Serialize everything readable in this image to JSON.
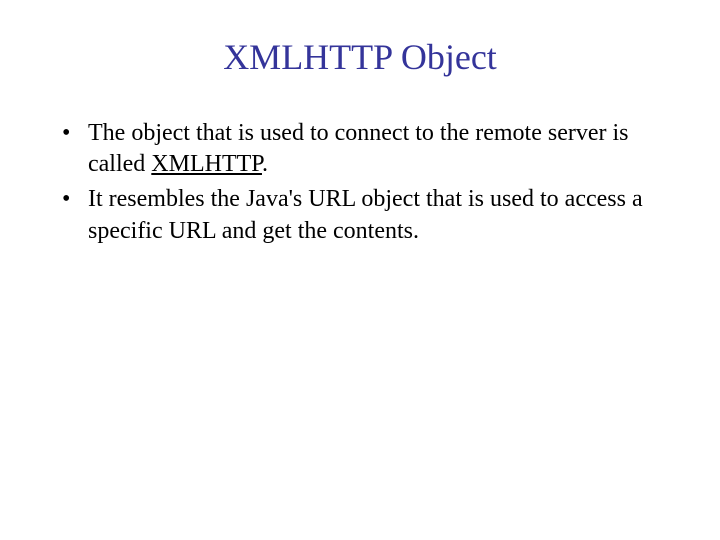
{
  "title": "XMLHTTP Object",
  "bullets": [
    {
      "marker": "•",
      "text_before": "The object that is used to connect to the remote server is called ",
      "underlined": "XMLHTTP",
      "text_after": "."
    },
    {
      "marker": "•",
      "text_before": "It resembles the Java's URL object that is used to access a specific URL and get the contents.",
      "underlined": "",
      "text_after": ""
    }
  ]
}
